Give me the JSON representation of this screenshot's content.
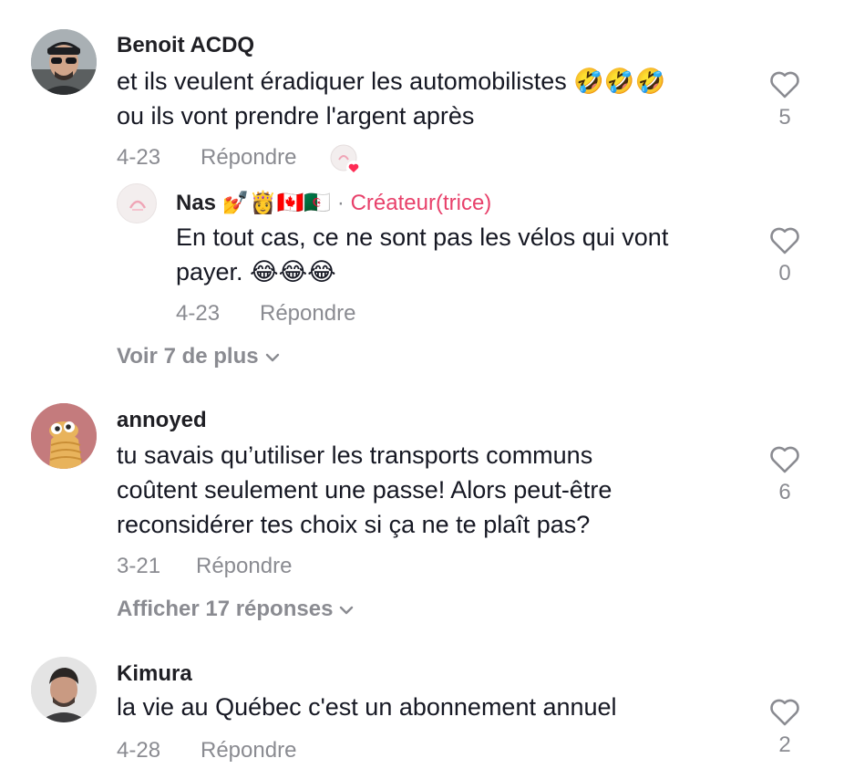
{
  "comments": [
    {
      "username": "Benoit ACDQ",
      "text_line1": "et ils veulent éradiquer les automobilistes 🤣🤣🤣",
      "text_line2": "ou ils vont prendre l'argent après",
      "date": "4-23",
      "reply_label": "Répondre",
      "likes": "5",
      "avatar_icon": "man-sunglasses-avatar",
      "creator_liked": true,
      "replies": [
        {
          "username": "Nas",
          "username_emojis": "💅👸🇨🇦🇩🇿",
          "separator": "·",
          "creator_label": "Créateur(trice)",
          "text_line1": "En tout cas, ce ne sont pas les vélos qui vont",
          "text_line2": "payer. 😂😂😂",
          "date": "4-23",
          "reply_label": "Répondre",
          "likes": "0"
        }
      ],
      "more_label": "Voir 7 de plus"
    },
    {
      "username": "annoyed",
      "text_line1": "tu savais qu’utiliser les transports communs",
      "text_line2": "coûtent seulement une passe! Alors peut-être",
      "text_line3": "reconsidérer tes choix si ça ne te plaît pas?",
      "date": "3-21",
      "reply_label": "Répondre",
      "likes": "6",
      "avatar_icon": "cartoon-creature-avatar",
      "more_label": "Afficher 17 réponses"
    },
    {
      "username": "Kimura",
      "text_line1": "la vie au Québec c'est un abonnement annuel",
      "date": "4-28",
      "reply_label": "Répondre",
      "likes": "2",
      "avatar_icon": "man-photo-avatar"
    }
  ],
  "colors": {
    "text": "#161823",
    "muted": "#8a8b91",
    "creator": "#e8416b",
    "like_heart": "#8a8b91",
    "creator_heart": "#fe2c55"
  }
}
